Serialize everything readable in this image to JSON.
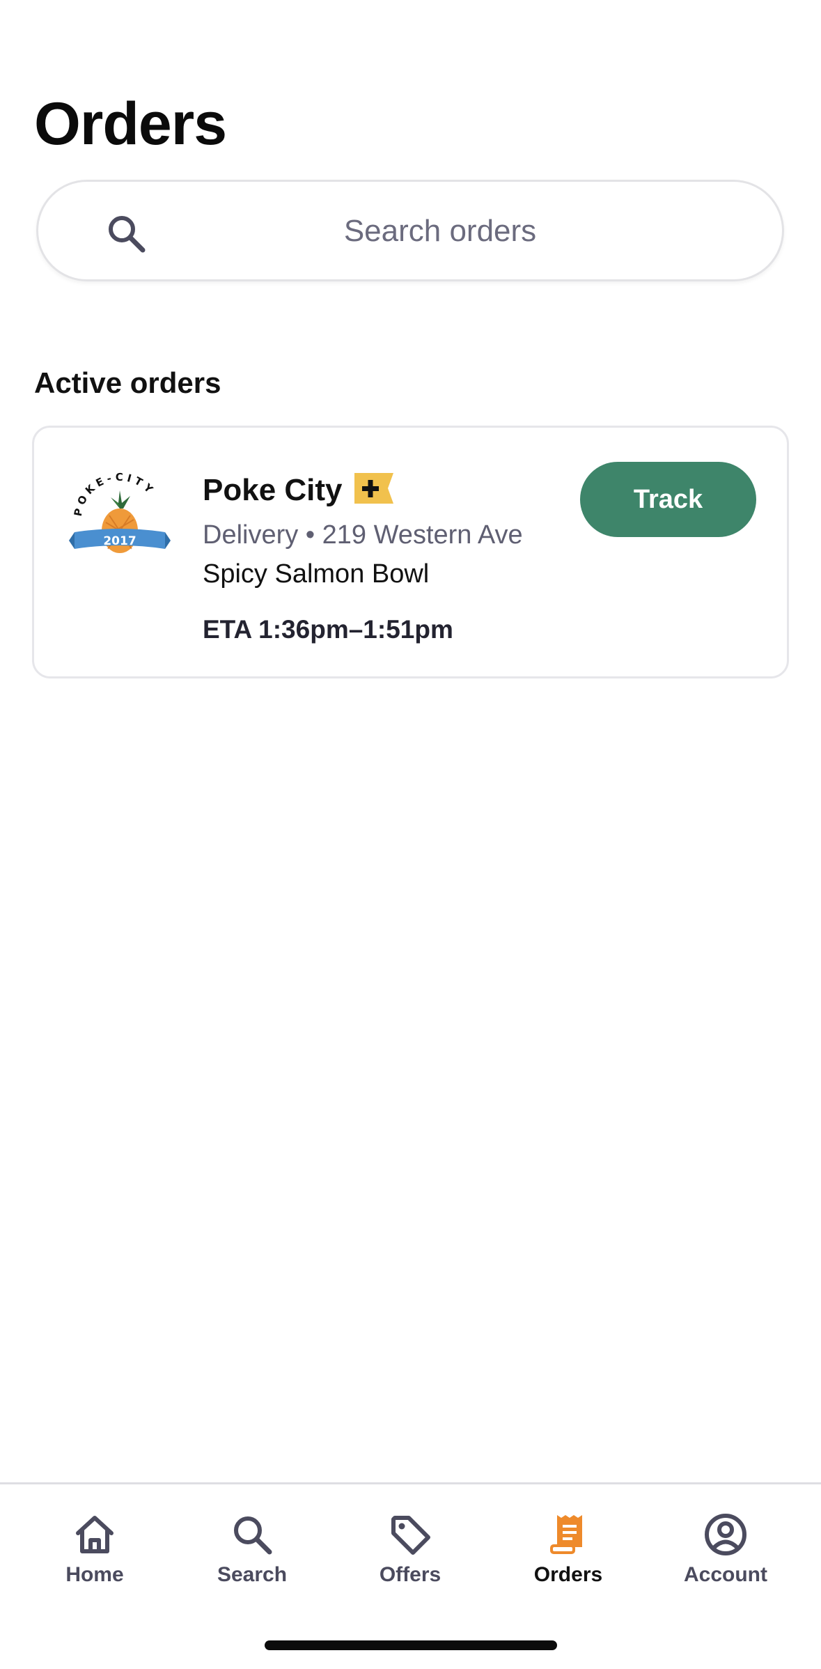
{
  "page": {
    "title": "Orders"
  },
  "search": {
    "placeholder": "Search orders",
    "value": "",
    "icon": "search-icon"
  },
  "active_orders": {
    "heading": "Active orders",
    "orders": [
      {
        "store_name": "Poke City",
        "store_logo": "poke-city-logo",
        "logo_text": "POKE-CITY",
        "logo_year": "2017",
        "badge_icon": "plus-badge-icon",
        "meta": "Delivery • 219 Western Ave",
        "item": "Spicy Salmon Bowl",
        "eta": "ETA 1:36pm–1:51pm",
        "action_label": "Track"
      }
    ]
  },
  "tab_bar": {
    "active": "Orders",
    "tabs": [
      {
        "label": "Home",
        "icon": "home-icon"
      },
      {
        "label": "Search",
        "icon": "search-icon"
      },
      {
        "label": "Offers",
        "icon": "tag-icon"
      },
      {
        "label": "Orders",
        "icon": "receipt-icon"
      },
      {
        "label": "Account",
        "icon": "account-icon"
      }
    ]
  },
  "colors": {
    "accent_green": "#3e856a",
    "active_tab_orange": "#ee8a2b",
    "plus_badge_yellow": "#f1c14d",
    "muted_text": "#5f5f72"
  }
}
